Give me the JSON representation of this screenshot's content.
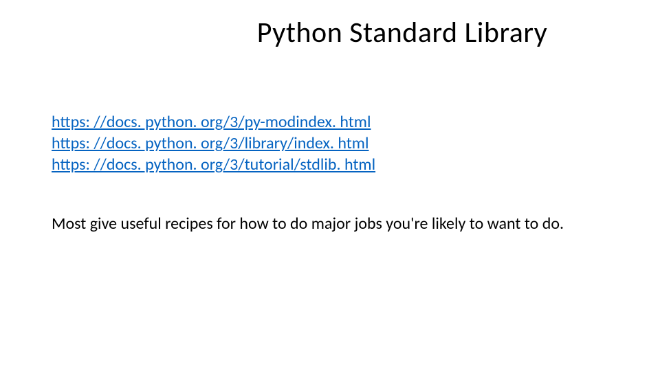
{
  "title": "Python Standard Library",
  "links": [
    "https: //docs. python. org/3/py-modindex. html",
    "https: //docs. python. org/3/library/index. html",
    "https: //docs. python. org/3/tutorial/stdlib. html"
  ],
  "paragraph": "Most give useful recipes for how to do major jobs you're likely to want to do."
}
